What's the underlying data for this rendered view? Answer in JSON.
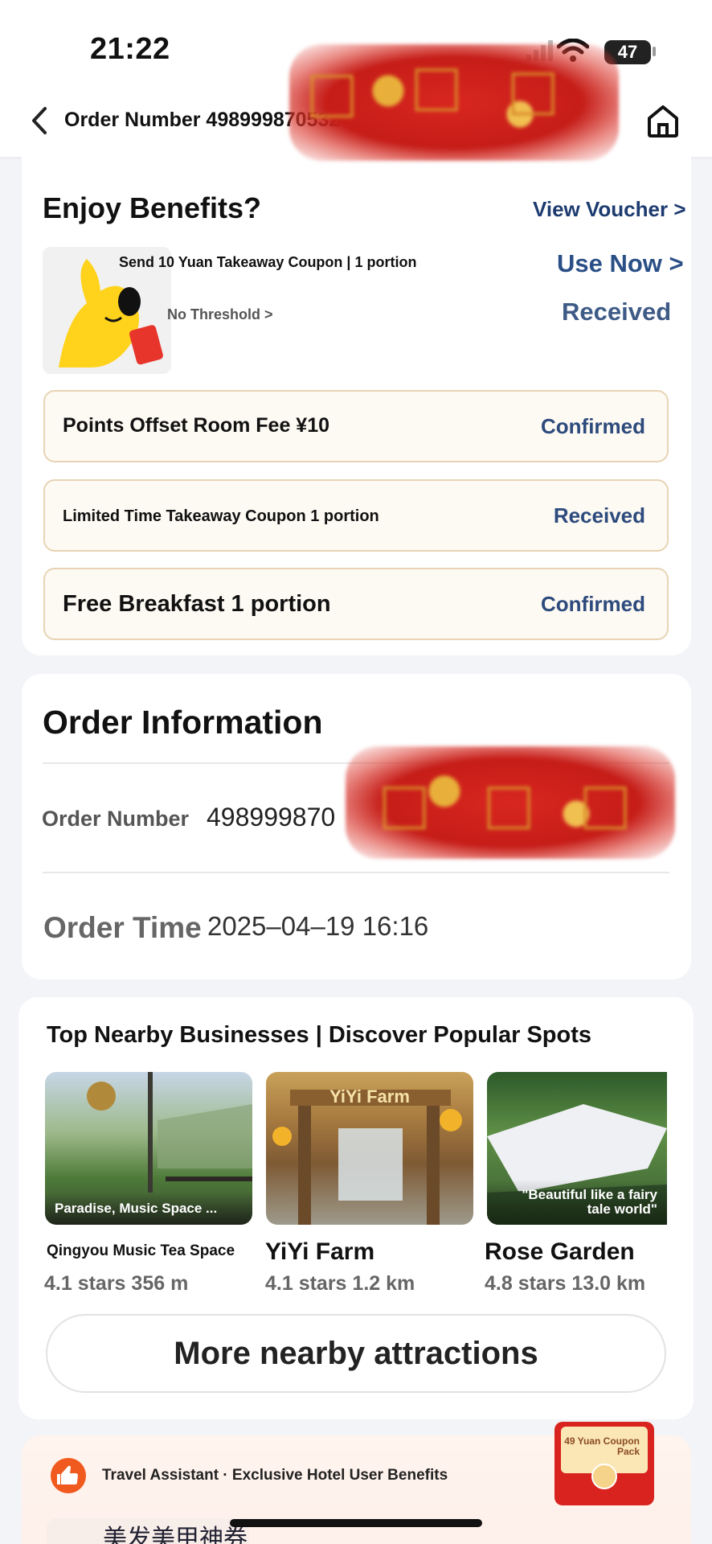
{
  "status_bar": {
    "time": "21:22",
    "battery": "47"
  },
  "nav": {
    "title": "Order Number 498999870532"
  },
  "benefits": {
    "title": "Enjoy Benefits?",
    "view_voucher": "View Voucher >",
    "coupon": {
      "title": "Send 10 Yuan Takeaway Coupon | 1 portion",
      "threshold": "No Threshold >",
      "use_now": "Use Now >",
      "status": "Received"
    },
    "items": [
      {
        "label": "Points Offset Room Fee ¥10",
        "status": "Confirmed"
      },
      {
        "label": "Limited Time Takeaway Coupon 1 portion",
        "status": "Received"
      },
      {
        "label": "Free Breakfast 1 portion",
        "status": "Confirmed"
      }
    ]
  },
  "order_info": {
    "title": "Order Information",
    "order_number_label": "Order Number",
    "order_number_value": "498999870",
    "order_time_label": "Order Time",
    "order_time_value": "2025–04–19 16:16"
  },
  "nearby": {
    "title": "Top Nearby Businesses | Discover Popular Spots",
    "spots": [
      {
        "caption": "Paradise, Music Space ...",
        "name": "Qingyou Music Tea Space",
        "meta": "4.1 stars 356 m"
      },
      {
        "caption": "YiYi Farm",
        "name": "YiYi Farm",
        "meta": "4.1 stars 1.2 km"
      },
      {
        "caption": "\"Beautiful like a fairy tale world\"",
        "name": "Rose Garden",
        "meta": "4.8 stars 13.0 km"
      }
    ],
    "more_button": "More nearby attractions"
  },
  "assistant": {
    "text": "Travel Assistant · Exclusive Hotel User Benefits",
    "red_packet": "49 Yuan Coupon Pack",
    "bottom_tile": "美发美甲神券"
  },
  "colors": {
    "accent_blue": "#1d3b70",
    "bar_border": "#e8d4b4",
    "bar_bg": "#fdf9f3"
  }
}
